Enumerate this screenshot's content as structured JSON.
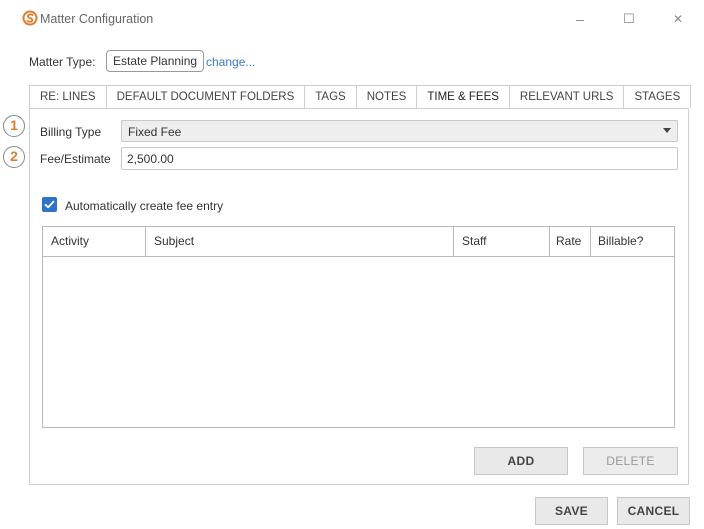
{
  "window": {
    "title": "Matter Configuration",
    "minimize_glyph": "–",
    "maximize_glyph": "☐",
    "close_glyph": "✕",
    "icon": "app-logo-icon",
    "accent_color": "#e07b2c"
  },
  "matter": {
    "label": "Matter Type:",
    "type": "Estate Planning",
    "change_link": "change..."
  },
  "tabs": [
    {
      "label": "RE: LINES",
      "active": false
    },
    {
      "label": "DEFAULT DOCUMENT FOLDERS",
      "active": false
    },
    {
      "label": "TAGS",
      "active": false
    },
    {
      "label": "NOTES",
      "active": false
    },
    {
      "label": "TIME & FEES",
      "active": true
    },
    {
      "label": "RELEVANT URLS",
      "active": false
    },
    {
      "label": "STAGES",
      "active": false
    }
  ],
  "form": {
    "billing_type_label": "Billing Type",
    "billing_type_value": "Fixed Fee",
    "fee_label": "Fee/Estimate",
    "fee_value": "2,500.00",
    "marker_1": "1",
    "marker_2": "2",
    "auto_fee_label": "Automatically create fee entry",
    "auto_fee_checked": true
  },
  "grid": {
    "columns": [
      "Activity",
      "Subject",
      "Staff",
      "Rate",
      "Billable?"
    ],
    "rows": []
  },
  "buttons": {
    "add": "ADD",
    "delete": "DELETE",
    "save": "SAVE",
    "cancel": "CANCEL"
  }
}
